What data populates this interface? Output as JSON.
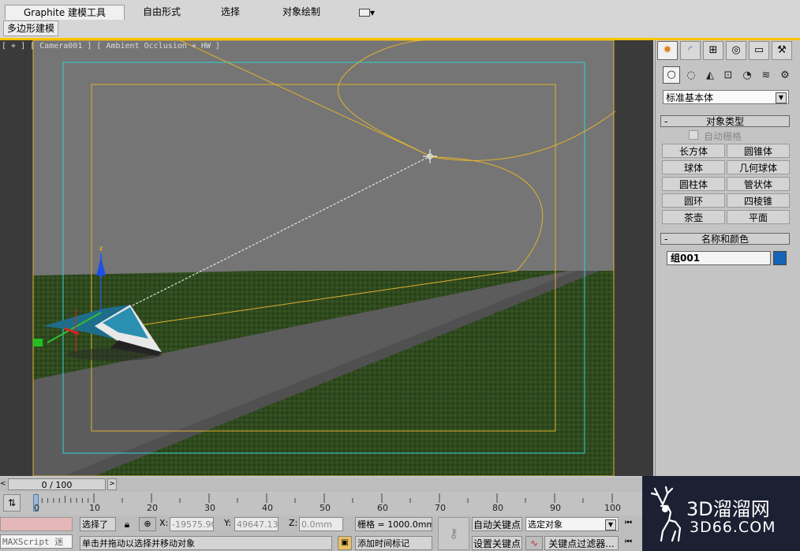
{
  "ribbon": {
    "tabs": [
      "Graphite 建模工具",
      "自由形式",
      "选择",
      "对象绘制"
    ],
    "subtab": "多边形建模"
  },
  "viewport": {
    "label": "[ + ] [ Camera001 ] [ Ambient Occlusion + HW ]"
  },
  "command_panel": {
    "tabs": [
      "create",
      "modify",
      "hierarchy",
      "motion",
      "display",
      "utilities"
    ],
    "subtabs": [
      "geometry",
      "shapes",
      "lights",
      "cameras",
      "helpers",
      "spacewarps",
      "systems"
    ],
    "category": "标准基本体",
    "object_type": {
      "title": "对象类型",
      "autogrid_label": "自动栅格",
      "buttons": [
        "长方体",
        "圆锥体",
        "球体",
        "几何球体",
        "圆柱体",
        "管状体",
        "圆环",
        "四棱锥",
        "茶壶",
        "平面"
      ]
    },
    "name_color": {
      "title": "名称和颜色",
      "name": "组001",
      "color": "#1664b4"
    }
  },
  "timeline": {
    "slider": "0 / 100",
    "ticks": [
      "0",
      "10",
      "20",
      "30",
      "40",
      "50",
      "60",
      "70",
      "80",
      "90",
      "100"
    ]
  },
  "status": {
    "maxscript": "MAXScript 迷",
    "selected": "选择了",
    "x_label": "X:",
    "x_value": "-19575.903",
    "y_label": "Y:",
    "y_value": "49647.134",
    "z_label": "Z:",
    "z_value": "0.0mm",
    "grid": "栅格 = 1000.0mm",
    "prompt": "单击并拖动以选择并移动对象",
    "add_time_tag": "添加时间标记",
    "auto_key": "自动关键点",
    "set_key": "设置关键点",
    "selection_set": "选定对象",
    "key_filters": "关键点过滤器..."
  },
  "watermark": {
    "brand": "3D溜溜网",
    "url": "3D66.COM"
  },
  "colors": {
    "highlight": "#ffc400",
    "safe_frame": "#2fd3d3",
    "spline": "#e0b030"
  }
}
